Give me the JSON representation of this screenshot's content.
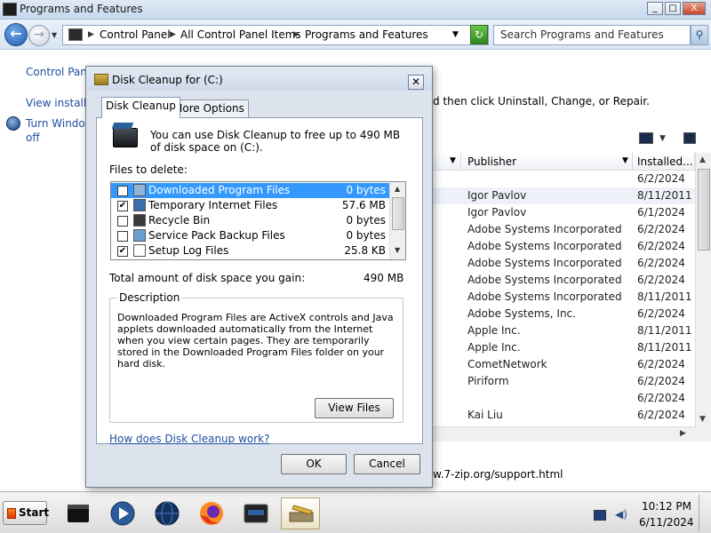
{
  "window": {
    "title": "Programs and Features",
    "buttons": {
      "minimize": "_",
      "maximize": "□",
      "close": "X"
    }
  },
  "nav": {
    "back_glyph": "←",
    "forward_glyph": "→",
    "breadcrumbs": [
      "Control Panel",
      "All Control Panel Items",
      "Programs and Features"
    ],
    "refresh_glyph": "↻",
    "search_placeholder": "Search Programs and Features",
    "search_glyph": "⚲"
  },
  "sidebar": {
    "links": [
      {
        "label": "Control Panel"
      },
      {
        "label": "View installed"
      },
      {
        "label": "Turn Window"
      },
      {
        "label": "off"
      }
    ]
  },
  "main": {
    "instruction_tail": "d then click Uninstall, Change, or Repair.",
    "columns": {
      "publisher": "Publisher",
      "installed": "Installed..."
    },
    "rows": [
      {
        "publisher": "",
        "installed": "6/2/2024"
      },
      {
        "publisher": "Igor Pavlov",
        "installed": "8/11/2011"
      },
      {
        "publisher": "Igor Pavlov",
        "installed": "6/1/2024"
      },
      {
        "publisher": "Adobe Systems Incorporated",
        "installed": "6/2/2024"
      },
      {
        "publisher": "Adobe Systems Incorporated",
        "installed": "6/2/2024"
      },
      {
        "publisher": "Adobe Systems Incorporated",
        "installed": "6/2/2024"
      },
      {
        "publisher": "Adobe Systems Incorporated",
        "installed": "6/2/2024"
      },
      {
        "publisher": "Adobe Systems Incorporated",
        "installed": "8/11/2011"
      },
      {
        "publisher": "Adobe Systems, Inc.",
        "installed": "6/2/2024"
      },
      {
        "publisher": "Apple Inc.",
        "installed": "8/11/2011"
      },
      {
        "publisher": "Apple Inc.",
        "installed": "8/11/2011"
      },
      {
        "publisher": "CometNetwork",
        "installed": "6/2/2024"
      },
      {
        "publisher": "Piriform",
        "installed": "6/2/2024"
      },
      {
        "publisher": "",
        "installed": "6/2/2024"
      },
      {
        "publisher": "Kai Liu",
        "installed": "6/2/2024"
      }
    ],
    "details_url": "w.7-zip.org/support.html"
  },
  "dialog": {
    "title": "Disk Cleanup for  (C:)",
    "close_glyph": "✕",
    "tabs": [
      {
        "label": "Disk Cleanup"
      },
      {
        "label": "More Options"
      }
    ],
    "intro": "You can use Disk Cleanup to free up to 490 MB of disk space on  (C:).",
    "files_label": "Files to delete:",
    "files": [
      {
        "name": "Downloaded Program Files",
        "size": "0 bytes",
        "checked": false,
        "selected": true
      },
      {
        "name": "Temporary Internet Files",
        "size": "57.6 MB",
        "checked": true,
        "selected": false
      },
      {
        "name": "Recycle Bin",
        "size": "0 bytes",
        "checked": false,
        "selected": false
      },
      {
        "name": "Service Pack Backup Files",
        "size": "0 bytes",
        "checked": false,
        "selected": false
      },
      {
        "name": "Setup Log Files",
        "size": "25.8 KB",
        "checked": true,
        "selected": false
      }
    ],
    "total_label": "Total amount of disk space you gain:",
    "total_value": "490 MB",
    "description_legend": "Description",
    "description": "Downloaded Program Files are ActiveX controls and Java applets downloaded automatically from the Internet when you view certain pages. They are temporarily stored in the Downloaded Program Files folder on your hard disk.",
    "view_files_label": "View Files",
    "help_link": "How does Disk Cleanup work?",
    "ok_label": "OK",
    "cancel_label": "Cancel"
  },
  "taskbar": {
    "start_label": "Start",
    "items": [
      {
        "icon": "server-icon"
      },
      {
        "icon": "media-player-icon"
      },
      {
        "icon": "globe-icon"
      },
      {
        "icon": "firefox-icon"
      },
      {
        "icon": "control-panel-icon"
      },
      {
        "icon": "disk-cleanup-icon"
      }
    ],
    "clock_time": "10:12 PM",
    "clock_date": "6/11/2024"
  },
  "colors": {
    "selection": "#3399ff",
    "link": "#1f4fa0",
    "dialog_frame": "#dce3ec"
  }
}
